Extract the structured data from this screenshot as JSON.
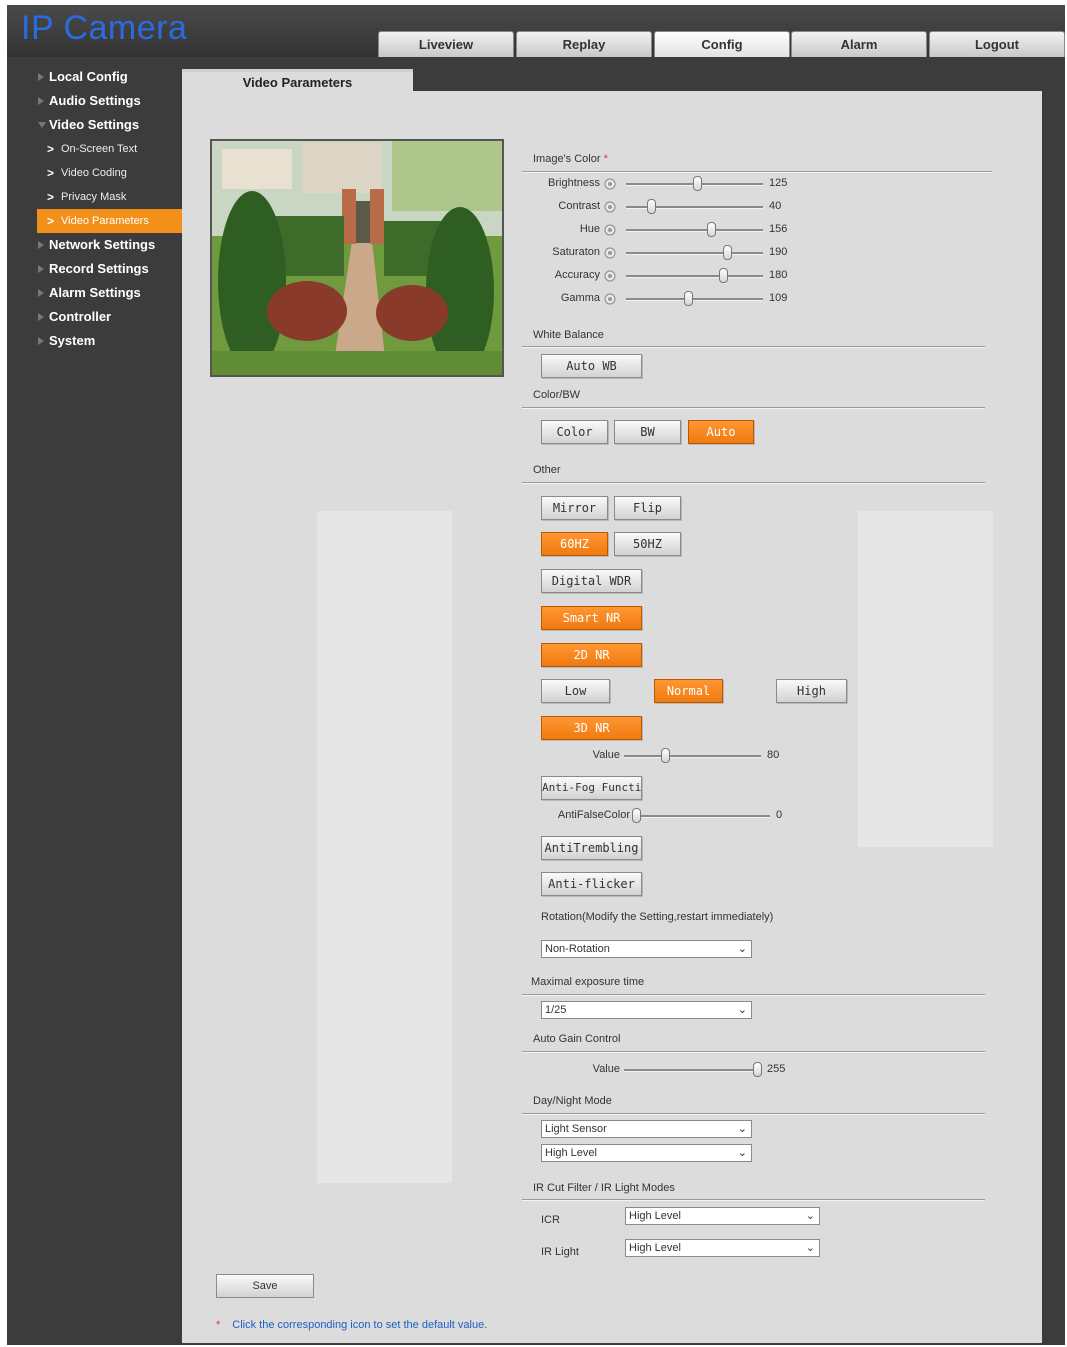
{
  "app": {
    "title": "IP Camera"
  },
  "nav_tabs": [
    {
      "label": "Liveview"
    },
    {
      "label": "Replay"
    },
    {
      "label": "Config",
      "active": true
    },
    {
      "label": "Alarm"
    },
    {
      "label": "Logout"
    }
  ],
  "sidebar": {
    "items": [
      {
        "label": "Local Config"
      },
      {
        "label": "Audio Settings"
      },
      {
        "label": "Video Settings",
        "expanded": true
      },
      {
        "label": "On-Screen Text"
      },
      {
        "label": "Video Coding"
      },
      {
        "label": "Privacy Mask"
      },
      {
        "label": "Video Parameters",
        "active": true
      },
      {
        "label": "Network Settings"
      },
      {
        "label": "Record Settings"
      },
      {
        "label": "Alarm Settings"
      },
      {
        "label": "Controller"
      },
      {
        "label": "System"
      }
    ]
  },
  "panel": {
    "tab_title": "Video Parameters",
    "image_color": {
      "label": "Image's Color",
      "required_mark": "*",
      "sliders": [
        {
          "label": "Brightness",
          "value": "125",
          "icon": "sun-icon",
          "level": 0.52
        },
        {
          "label": "Contrast",
          "value": "40",
          "icon": "contrast-icon",
          "level": 0.18
        },
        {
          "label": "Hue",
          "value": "156",
          "icon": "hue-icon",
          "level": 0.62
        },
        {
          "label": "Saturaton",
          "value": "190",
          "icon": "saturation-icon",
          "level": 0.74
        },
        {
          "label": "Accuracy",
          "value": "180",
          "icon": "accuracy-icon",
          "level": 0.71
        },
        {
          "label": "Gamma",
          "value": "109",
          "icon": "gamma-icon",
          "level": 0.45
        }
      ]
    },
    "white_balance": {
      "label": "White Balance",
      "button": "Auto WB"
    },
    "color_bw": {
      "label": "Color/BW",
      "buttons": [
        "Color",
        "BW",
        "Auto"
      ],
      "selected": "Auto"
    },
    "other": {
      "label": "Other",
      "mirror": "Mirror",
      "flip": "Flip",
      "hz60": "60HZ",
      "hz50": "50HZ",
      "digital_wdr": "Digital WDR",
      "smart_nr": "Smart NR",
      "nr2d": "2D NR",
      "low": "Low",
      "normal": "Normal",
      "high": "High",
      "nr3d": "3D NR",
      "nr_value_label": "Value",
      "nr_value": "80",
      "nr_value_level": 0.3,
      "anti_fog": "Anti-Fog Function",
      "anti_false_color_label": "AntiFalseColor",
      "anti_false_color_value": "0",
      "anti_false_color_level": 0.0,
      "anti_trembling": "AntiTrembling",
      "anti_flicker": "Anti-flicker"
    },
    "rotation": {
      "label": "Rotation(Modify the Setting,restart immediately)",
      "value": "Non-Rotation"
    },
    "exposure": {
      "label": "Maximal exposure time",
      "value": "1/25"
    },
    "agc": {
      "label": "Auto Gain Control",
      "value_label": "Value",
      "value": "255",
      "level": 1.0
    },
    "day_night": {
      "label": "Day/Night Mode",
      "mode": "Light Sensor",
      "level": "High Level"
    },
    "ir_cut": {
      "label": "IR Cut Filter / IR Light Modes",
      "icr_label": "ICR",
      "icr_value": "High Level",
      "ir_light_label": "IR Light",
      "ir_light_value": "High Level"
    },
    "save_label": "Save",
    "note_mark": "*",
    "note": "Click the corresponding icon to set the default value."
  }
}
